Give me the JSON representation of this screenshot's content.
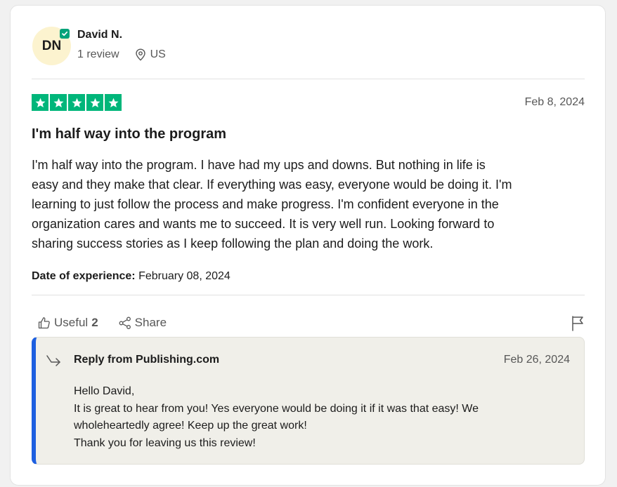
{
  "reviewer": {
    "initials": "DN",
    "name": "David N.",
    "review_count": "1 review",
    "country": "US"
  },
  "review": {
    "rating": 5,
    "rating_max": 5,
    "date": "Feb 8, 2024",
    "title": "I'm half way into the program",
    "body_lines": [
      "I'm half way into the program. I have had my ups and downs. But nothing in life is",
      "easy and they make that clear. If everything was easy, everyone would be doing it. I'm",
      "learning to just follow the process and make progress. I'm confident everyone in the",
      "organization cares and wants me to succeed. It is very well run. Looking forward to",
      "sharing success stories as I keep following the plan and doing the work."
    ],
    "experience_label": "Date of experience:",
    "experience_date": "February 08, 2024"
  },
  "actions": {
    "useful_label": "Useful",
    "useful_count": "2",
    "share_label": "Share"
  },
  "reply": {
    "from": "Reply from Publishing.com",
    "date": "Feb 26, 2024",
    "lines": [
      "Hello David,",
      "It is great to hear from you! Yes everyone would be doing it if it was that easy! We",
      "wholeheartedly agree! Keep up the great work!",
      "Thank you for leaving us this review!"
    ]
  },
  "icons": {
    "verified": "verified-check-icon",
    "location": "location-pin-icon",
    "star": "star-icon",
    "useful": "thumbs-up-icon",
    "share": "share-icon",
    "flag": "flag-icon",
    "reply": "reply-arrow-icon"
  },
  "colors": {
    "star_green": "#00b67a",
    "verified_green": "#04a37a",
    "avatar_bg": "#fcf3cf",
    "reply_accent": "#1d5fe0",
    "reply_bg": "#f0efe9"
  }
}
